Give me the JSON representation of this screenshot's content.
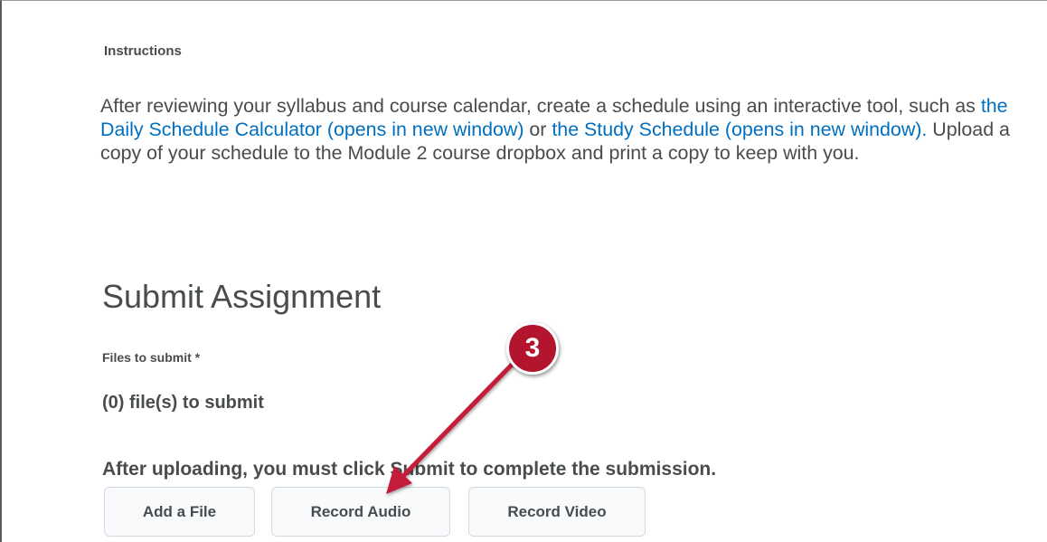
{
  "instructions": {
    "label": "Instructions",
    "text_part1": "After reviewing your syllabus and course calendar, create a schedule using an interactive tool, such as ",
    "link1": "the Daily Schedule Calculator (opens in new window)",
    "text_part2": " or ",
    "link2": "the Study Schedule (opens in new window).",
    "text_part3": " Upload a copy of your schedule to the Module 2 course dropbox and print a copy to keep with you."
  },
  "submit": {
    "title": "Submit Assignment",
    "files_label": "Files to submit *",
    "file_count": "(0) file(s) to submit",
    "note": "After uploading, you must click Submit to complete the submission.",
    "buttons": {
      "add_file": "Add a File",
      "record_audio": "Record Audio",
      "record_video": "Record Video"
    }
  },
  "annotation": {
    "step_number": "3",
    "badge_color": "#b3142e"
  },
  "colors": {
    "text": "#494c4e",
    "link": "#006fbf",
    "button_bg": "#f9fafb",
    "button_border": "#d3d9e3"
  }
}
